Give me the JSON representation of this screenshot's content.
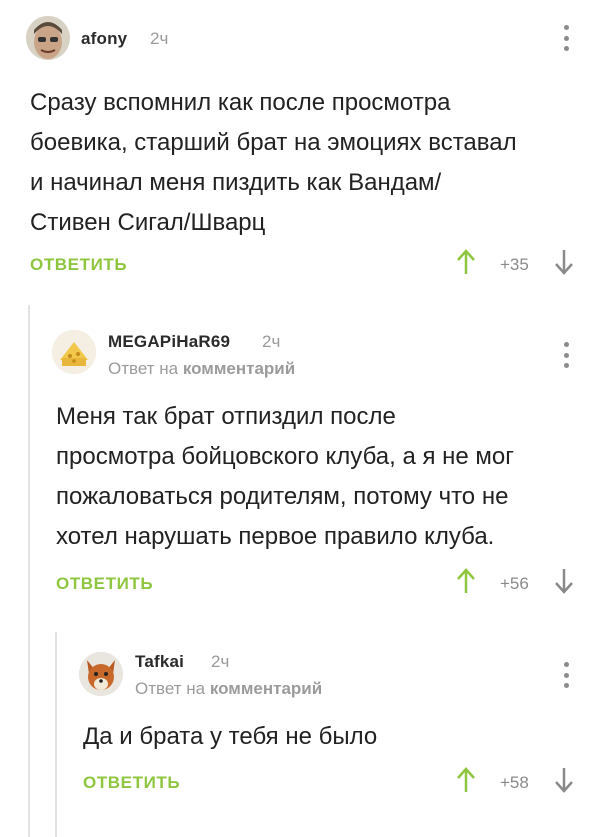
{
  "comments": [
    {
      "username": "afony",
      "time": "2ч",
      "text_lines": [
        "Сразу вспомнил как после просмотра",
        "боевика, старший брат на эмоциях вставал",
        "и начинал меня пиздить как Вандам/",
        "Стивен Сигал/Шварц"
      ],
      "reply_label": "ОТВЕТИТЬ",
      "votes": "+35"
    },
    {
      "username": "MEGAPiHaR69",
      "time": "2ч",
      "reply_prefix": "Ответ на",
      "reply_target": "комментарий",
      "text_lines": [
        "Меня так брат отпиздил после",
        "просмотра бойцовского клуба, а я не мог",
        "пожаловаться родителям, потому что не",
        "хотел нарушать первое правило клуба."
      ],
      "reply_label": "ОТВЕТИТЬ",
      "votes": "+56"
    },
    {
      "username": "Tafkai",
      "time": "2ч",
      "reply_prefix": "Ответ на",
      "reply_target": "комментарий",
      "text_lines": [
        "Да и брата у тебя не было"
      ],
      "reply_label": "ОТВЕТИТЬ",
      "votes": "+58"
    }
  ],
  "colors": {
    "accent": "#8ec63f",
    "vote_up": "#8ec63f",
    "vote_down": "#8a8a8a",
    "muted": "#9a9a9a"
  },
  "icons": [
    "menu-dots-icon",
    "arrow-up-icon",
    "arrow-down-icon"
  ]
}
